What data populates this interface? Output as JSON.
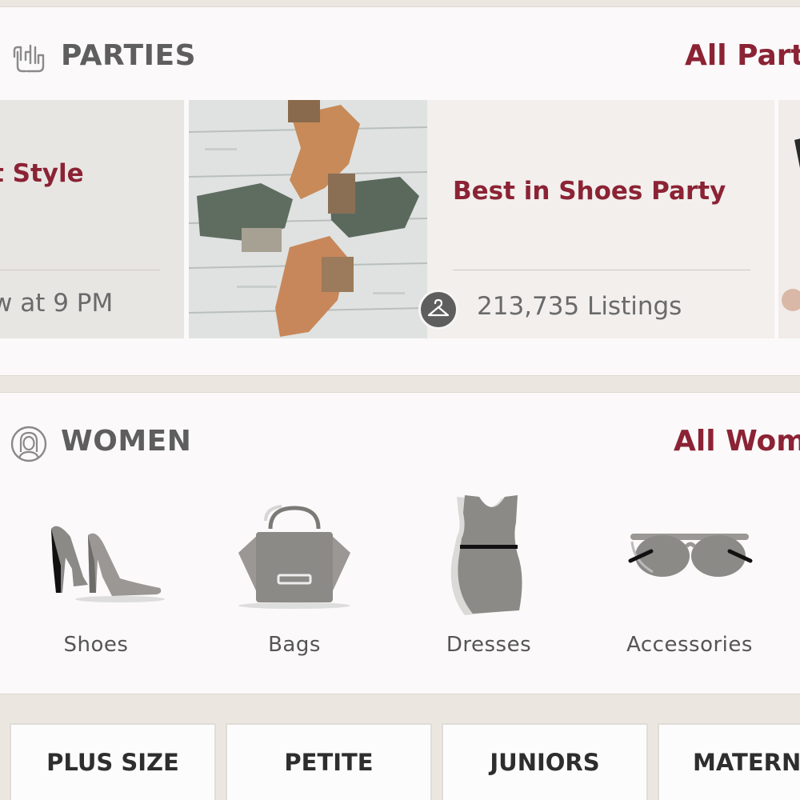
{
  "parties": {
    "title": "PARTIES",
    "all_link": "All Parties",
    "cards": [
      {
        "title": "t Style",
        "subtitle": "w at 9 PM"
      },
      {
        "title": "Best in Shoes Party",
        "subtitle": "213,735 Listings"
      }
    ]
  },
  "women": {
    "title": "WOMEN",
    "all_link": "All Women",
    "categories": [
      {
        "label": "Shoes",
        "icon": "high-heels-icon"
      },
      {
        "label": "Bags",
        "icon": "handbag-icon"
      },
      {
        "label": "Dresses",
        "icon": "dress-icon"
      },
      {
        "label": "Accessories",
        "icon": "sunglasses-icon"
      }
    ]
  },
  "size_chips": [
    "PLUS SIZE",
    "PETITE",
    "JUNIORS",
    "MATERNITY"
  ],
  "colors": {
    "accent": "#8b2334",
    "heading": "#5e5e5e",
    "background": "#ebe7e0",
    "panel": "#fbf9f9"
  }
}
